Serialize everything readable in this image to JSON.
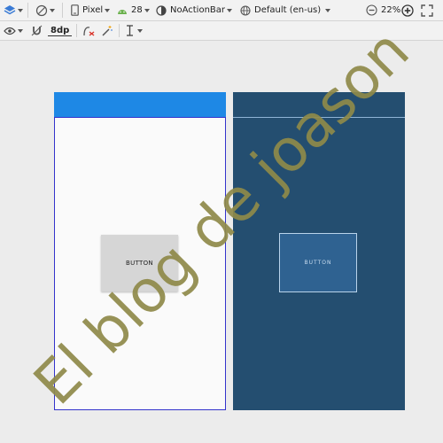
{
  "toolbar_top": {
    "device": "Pixel",
    "api_level": "28",
    "theme": "NoActionBar",
    "locale": "Default (en-us)",
    "zoom": "22%",
    "icons": [
      "layers-icon",
      "orientation-icon",
      "device-icon",
      "android-icon",
      "theme-icon",
      "globe-icon",
      "zoom-out-icon",
      "zoom-in-icon",
      "zoom-fit-icon"
    ]
  },
  "toolbar_secondary": {
    "margin_value": "8dp",
    "icons": [
      "eye-icon",
      "magnet-icon",
      "clear-constraints-icon",
      "infer-constraints-icon",
      "guidelines-icon"
    ]
  },
  "design_view": {
    "appbar_color": "#1e88e5",
    "button_label": "BUTTON"
  },
  "blueprint_view": {
    "background_color": "#244e70",
    "button_label": "BUTTON"
  },
  "watermark": "El blog de joason"
}
